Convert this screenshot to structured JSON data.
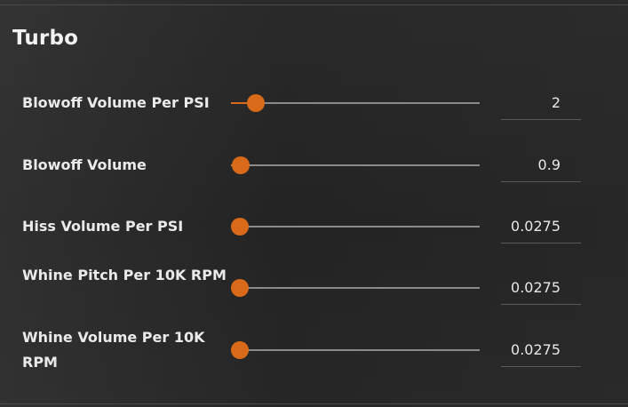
{
  "section": {
    "title": "Turbo"
  },
  "accent_color": "#d96a1a",
  "settings": [
    {
      "label": "Blowoff Volume Per PSI",
      "value": "2",
      "slider_fraction": 0.1
    },
    {
      "label": "Blowoff Volume",
      "value": "0.9",
      "slider_fraction": 0.04
    },
    {
      "label": "Hiss Volume Per PSI",
      "value": "0.0275",
      "slider_fraction": 0.035
    },
    {
      "label": "Whine Pitch Per 10K RPM",
      "value": "0.0275",
      "slider_fraction": 0.035
    },
    {
      "label": "Whine Volume Per 10K RPM",
      "value": "0.0275",
      "slider_fraction": 0.035
    }
  ]
}
